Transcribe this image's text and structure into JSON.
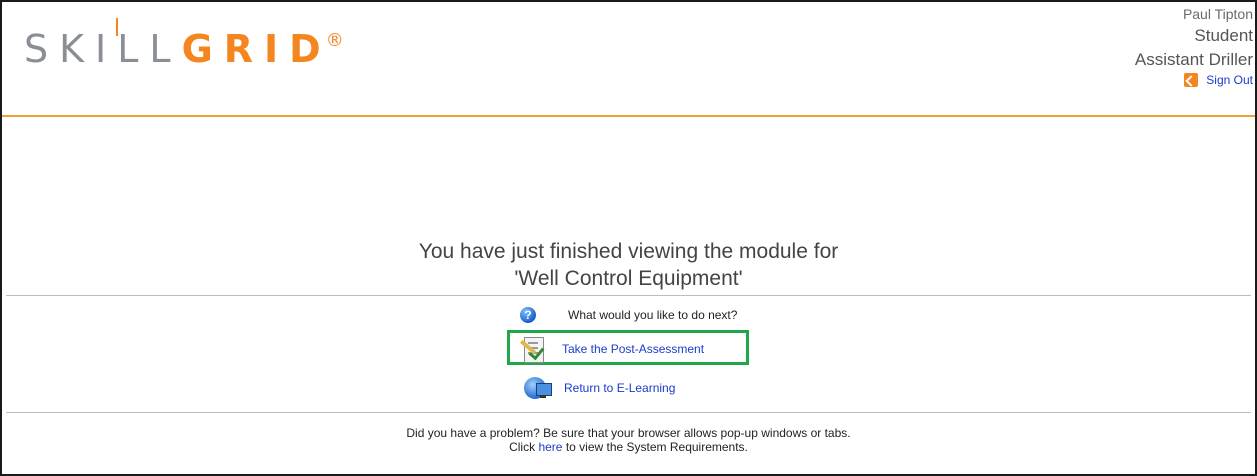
{
  "brand": {
    "logo_skill": "SKILL",
    "logo_grid": "GRID",
    "logo_reg": "®",
    "accent_color": "#f5861f"
  },
  "user": {
    "name": "Paul Tipton",
    "role": "Student",
    "title": "Assistant Driller",
    "sign_out_label": "Sign Out"
  },
  "message": {
    "line1": "You have just finished viewing the module for",
    "line2": "'Well Control Equipment'"
  },
  "next_steps": {
    "prompt": "What would you like to do next?",
    "post_assessment_label": "Take the Post-Assessment",
    "return_label": "Return to E-Learning",
    "highlight_color": "#1fa84a"
  },
  "footer": {
    "problem_text": "Did you have a problem? Be sure that your browser allows pop-up windows or tabs.",
    "click_prefix": "Click",
    "here_link": "here",
    "click_suffix": "to view the System Requirements."
  },
  "icons": {
    "help": "question-circle-icon",
    "assessment": "assessment-checklist-icon",
    "elearning": "globe-computer-icon",
    "signout": "sign-out-icon"
  }
}
